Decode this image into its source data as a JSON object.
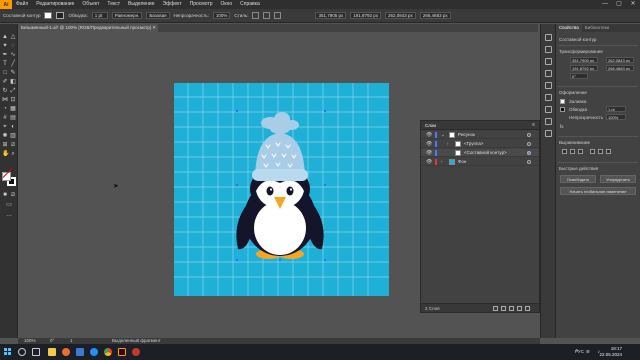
{
  "menu": {
    "logo": "Ai",
    "items": [
      "Файл",
      "Редактирование",
      "Объект",
      "Текст",
      "Выделение",
      "Эффект",
      "Просмотр",
      "Окно",
      "Справка"
    ],
    "win_min": "—",
    "win_max": "▢",
    "win_close": "✕"
  },
  "control": {
    "group_label": "Составной контур",
    "stroke_label": "Обводка:",
    "stroke_value": "1 pt",
    "profile": "Равномерн.",
    "brush": "Базовая",
    "opacity_label": "Непрозрачность:",
    "opacity_value": "100%",
    "style_label": "Стиль:",
    "x_value": "351,7905 px",
    "y_value": "191,8792 px",
    "w_value": "262,0843 px",
    "h_value": "266,4683 px"
  },
  "document": {
    "tab_title": "Безымянный-1.ai* @ 100% (RGB/Предварительный просмотр)",
    "close": "✕"
  },
  "properties": {
    "tab_properties": "Свойства",
    "tab_libraries": "Библиотеки",
    "section_object": "Составной контур",
    "section_transform": "Трансформирование",
    "x_value": "351,7905 px",
    "y_value": "191,8792 px",
    "w_value": "262,0843 px",
    "h_value": "266,4683 px",
    "angle_value": "0°",
    "section_appearance": "Оформление",
    "fill_label": "Заливка",
    "stroke_label": "Обводка",
    "stroke_value": "1 pt",
    "opacity_label": "Непрозрачность",
    "opacity_value": "100%",
    "fx_label": "fx",
    "section_align": "Выравнивание",
    "section_quick": "Быстрые действия",
    "btn_release": "Освободить",
    "btn_arrange": "Упорядочить",
    "btn_recolor": "Начать глобальное изменение"
  },
  "layers": {
    "title": "Слои",
    "menu": "≡",
    "rows": [
      {
        "name": "Рисунок",
        "arrow": "⌄",
        "color": "#4a7bff",
        "indent": 0
      },
      {
        "name": "<Группа>",
        "arrow": "›",
        "color": "#4a7bff",
        "indent": 1
      },
      {
        "name": "<Составной контур>",
        "arrow": "",
        "color": "#4a7bff",
        "indent": 1
      },
      {
        "name": "Фон",
        "arrow": "›",
        "color": "#e0383f",
        "indent": 0
      }
    ],
    "footer": "2 Слоя"
  },
  "status": {
    "zoom": "100%",
    "angle": "0°",
    "page": "1",
    "tool": "Выделенный фрагмент"
  },
  "taskbar": {
    "language": "РУС",
    "time": "18:17",
    "date": "22.05.2024"
  },
  "colors": {
    "artboard_bg": "#1fb0d8",
    "hat": "#a9cde6",
    "penguin_body": "#14142a",
    "belly": "#ffffff",
    "beak_feet": "#f5a623",
    "app_accent": "#ff9a00"
  }
}
